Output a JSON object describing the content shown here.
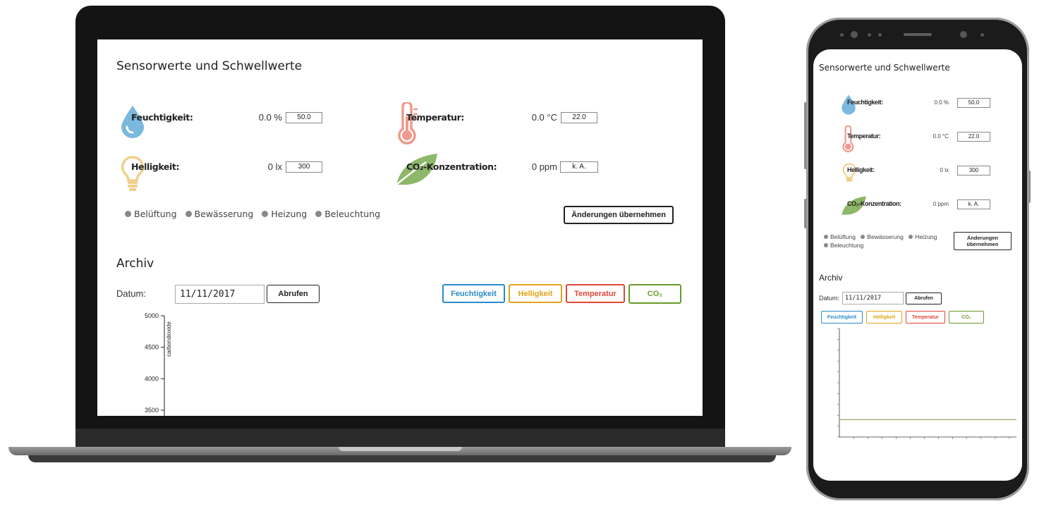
{
  "app": {
    "title": "Sensorwerte und Schwellwerte",
    "sensors": [
      {
        "name": "humidity",
        "label": "Feuchtigkeit:",
        "value": "0.0 %",
        "threshold": "50.0",
        "icon": "water-drop-icon"
      },
      {
        "name": "temperature",
        "label": "Temperatur:",
        "value": "0.0 °C",
        "threshold": "22.0",
        "icon": "thermometer-icon"
      },
      {
        "name": "brightness",
        "label": "Helligkeit:",
        "value": "0 lx",
        "threshold": "300",
        "icon": "light-bulb-icon"
      },
      {
        "name": "co2",
        "label": "CO₂-Konzentration:",
        "value": "0 ppm",
        "threshold": "k. A.",
        "icon": "leaf-icon"
      }
    ],
    "actuators": [
      "Belüftung",
      "Bewässerung",
      "Heizung",
      "Beleuchtung"
    ],
    "apply_label": "Änderungen übernehmen",
    "archive": {
      "title": "Archiv",
      "date_label": "Datum:",
      "date_value": "11/11/2017",
      "fetch_label": "Abrufen",
      "series_buttons": [
        {
          "label": "Feuchtigkeit",
          "color": "#2a8bc9"
        },
        {
          "label": "Helligkeit",
          "color": "#e0a417"
        },
        {
          "label": "Temperatur",
          "color": "#e0463a"
        },
        {
          "label": "CO₂",
          "color": "#6a9a2a"
        }
      ]
    }
  },
  "colors": {
    "humidity": "#7ab8dd",
    "temperature": "#ef9a8e",
    "brightness": "#f0d08a",
    "co2": "#8db86a",
    "actuator_off": "#888888"
  },
  "chart_data": {
    "type": "line",
    "ylabel": "carbondioxide",
    "yticks": [
      5000,
      4500,
      4000,
      3500
    ],
    "visible_range": [
      3500,
      5000
    ],
    "series": [
      {
        "values": []
      }
    ]
  },
  "phone_chart_data": {
    "type": "line",
    "ylim": [
      0,
      5000
    ],
    "series": [
      {
        "values": [
          800,
          800,
          800,
          800,
          800,
          800,
          800,
          800,
          800,
          800,
          800,
          800
        ]
      }
    ]
  }
}
